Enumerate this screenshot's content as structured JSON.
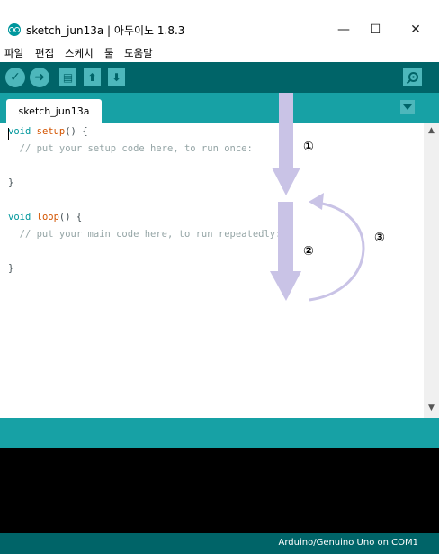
{
  "window": {
    "title": "sketch_jun13a | 아두이노 1.8.3",
    "minimize_glyph": "—",
    "maximize_glyph": "☐",
    "close_glyph": "✕"
  },
  "menu": [
    "파일",
    "편집",
    "스케치",
    "툴",
    "도움말"
  ],
  "toolbar": {
    "buttons": [
      {
        "name": "verify",
        "icon": "check-icon",
        "glyph": "✓"
      },
      {
        "name": "upload",
        "icon": "arrow-right-icon",
        "glyph": "➜"
      },
      {
        "name": "new",
        "icon": "new-file-icon",
        "glyph": "▤"
      },
      {
        "name": "open",
        "icon": "arrow-up-icon",
        "glyph": "⬆"
      },
      {
        "name": "save",
        "icon": "arrow-down-icon",
        "glyph": "⬇"
      }
    ],
    "serial_monitor_icon": "magnifier-icon"
  },
  "tabs": [
    {
      "label": "sketch_jun13a"
    }
  ],
  "code": {
    "l1_kw": "void",
    "l1_fn": "setup",
    "l1_rest": "() {",
    "l2": "  // put your setup code here, to run once:",
    "l4": "}",
    "l6_kw": "void",
    "l6_fn": "loop",
    "l6_rest": "() {",
    "l7": "  // put your main code here, to run repeatedly:",
    "l9": "}"
  },
  "annotations": {
    "label1": "①",
    "label2": "②",
    "label3": "③",
    "arrow_color": "#c9c3e6"
  },
  "status": {
    "board": "Arduino/Genuino Uno on COM1"
  },
  "colors": {
    "toolbar": "#006468",
    "tabbar": "#17a1a5",
    "button": "#4db7bb",
    "console": "#000000"
  }
}
